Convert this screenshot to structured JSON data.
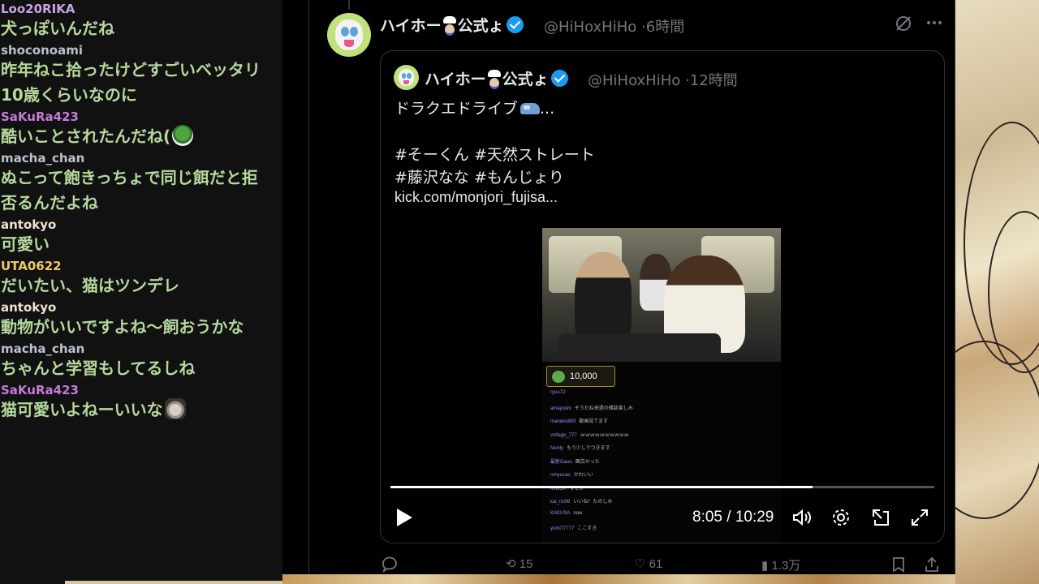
{
  "chat": {
    "messages": [
      {
        "user": "Loo20RIKA",
        "user_color": "#c8a6e6",
        "text": "犬っぽいんだね",
        "emote": ""
      },
      {
        "user": "shoconoami",
        "user_color": "#b9c2cc",
        "text": "昨年ねこ拾ったけどすごいベッタリ10歳くらいなのに",
        "emote": ""
      },
      {
        "user": "SaKuRa423",
        "user_color": "#c67ad8",
        "text": "酷いことされたんだね(",
        "emote": "frog-emote"
      },
      {
        "user": "macha_chan",
        "user_color": "#b9c2cc",
        "text": "ぬこって飽きっちょで同じ餌だと拒否るんだよね",
        "emote": ""
      },
      {
        "user": "antokyo",
        "user_color": "#f0e0d0",
        "text": "可愛い",
        "emote": ""
      },
      {
        "user": "UTA0622",
        "user_color": "#f0c86a",
        "text": "だいたい、猫はツンデレ",
        "emote": ""
      },
      {
        "user": "antokyo",
        "user_color": "#f0e0d0",
        "text": "動物がいいですよね～飼おうかな",
        "emote": ""
      },
      {
        "user": "macha_chan",
        "user_color": "#b9c2cc",
        "text": "ちゃんと学習もしてるしね",
        "emote": ""
      },
      {
        "user": "SaKuRa423",
        "user_color": "#c67ad8",
        "text": "猫可愛いよねーいいな",
        "emote": "cat-emote"
      }
    ]
  },
  "tweet": {
    "author_name": "ハイホー",
    "author_name_suffix": "公式ょ",
    "handle": "@HiHoxHiHo",
    "time": "6時間",
    "quote": {
      "author_name": "ハイホー",
      "author_name_suffix": "公式ょ",
      "handle": "@HiHoxHiHo",
      "time": "12時間",
      "lines": [
        "ドラクエドライブ",
        "",
        "#そーくん #天然ストレート",
        "#藤沢なな #もんじょり",
        "kick.com/monjori_fujisa..."
      ],
      "line1_suffix": "..."
    },
    "video": {
      "donation": "10,000",
      "chat_lines": [
        {
          "name": "ryuu72",
          "text": ""
        },
        {
          "name": "amayoshi",
          "text": "そうだね来週の雑談楽しみ"
        },
        {
          "name": "maneko893",
          "text": "動画見てます"
        },
        {
          "name": "voltage_777",
          "text": "ｗｗｗｗｗｗｗｗｗｗ"
        },
        {
          "name": "Nerdy",
          "text": "もう少しでつきます"
        },
        {
          "name": "最新Gaoo",
          "text": "面白かった"
        },
        {
          "name": "ronyucao",
          "text": "かわいい"
        },
        {
          "name": "MIDOR",
          "text": "すごい"
        },
        {
          "name": "kai_no08",
          "text": "いいね！たのしみ"
        },
        {
          "name": "KAKUSA",
          "text": "now"
        },
        {
          "name": "yumi77777",
          "text": "ここすき"
        }
      ],
      "progress": 0.776,
      "time_current": "8:05",
      "time_separator": " / ",
      "time_total": "10:29"
    },
    "actions": {
      "replies": "",
      "retweets": "15",
      "likes": "61",
      "views": "1.3万"
    }
  },
  "colors": {
    "background": "#000000",
    "chat_background": "#111111",
    "chat_text": "#b5d99c",
    "accent_verified": "#1d9bf0",
    "muted": "#71767b",
    "border": "#2f3336"
  },
  "icons": {
    "more": "more-icon",
    "grok": "grok-icon",
    "reply": "reply-icon",
    "retweet": "retweet-icon",
    "like": "like-icon",
    "views": "views-icon",
    "bookmark": "bookmark-icon",
    "share": "share-icon"
  }
}
